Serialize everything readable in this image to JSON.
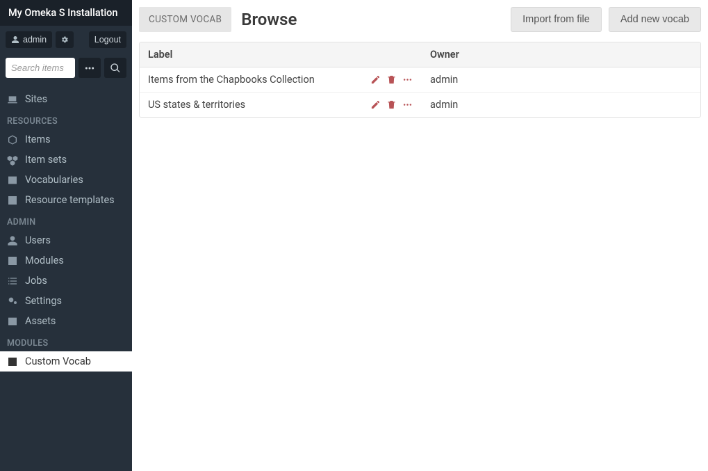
{
  "brand": "My Omeka S Installation",
  "user": {
    "name": "admin",
    "logout_label": "Logout"
  },
  "search": {
    "placeholder": "Search items"
  },
  "nav": {
    "sites": "Sites",
    "resources_header": "RESOURCES",
    "resources": [
      "Items",
      "Item sets",
      "Vocabularies",
      "Resource templates"
    ],
    "admin_header": "ADMIN",
    "admin": [
      "Users",
      "Modules",
      "Jobs",
      "Settings",
      "Assets"
    ],
    "modules_header": "MODULES",
    "modules": [
      "Custom Vocab"
    ]
  },
  "page": {
    "crumb": "CUSTOM VOCAB",
    "title": "Browse",
    "actions": {
      "import": "Import from file",
      "add": "Add new vocab"
    }
  },
  "table": {
    "headers": {
      "label": "Label",
      "owner": "Owner"
    },
    "rows": [
      {
        "label": "Items from the Chapbooks Collection",
        "owner": "admin"
      },
      {
        "label": "US states & territories",
        "owner": "admin"
      }
    ]
  }
}
